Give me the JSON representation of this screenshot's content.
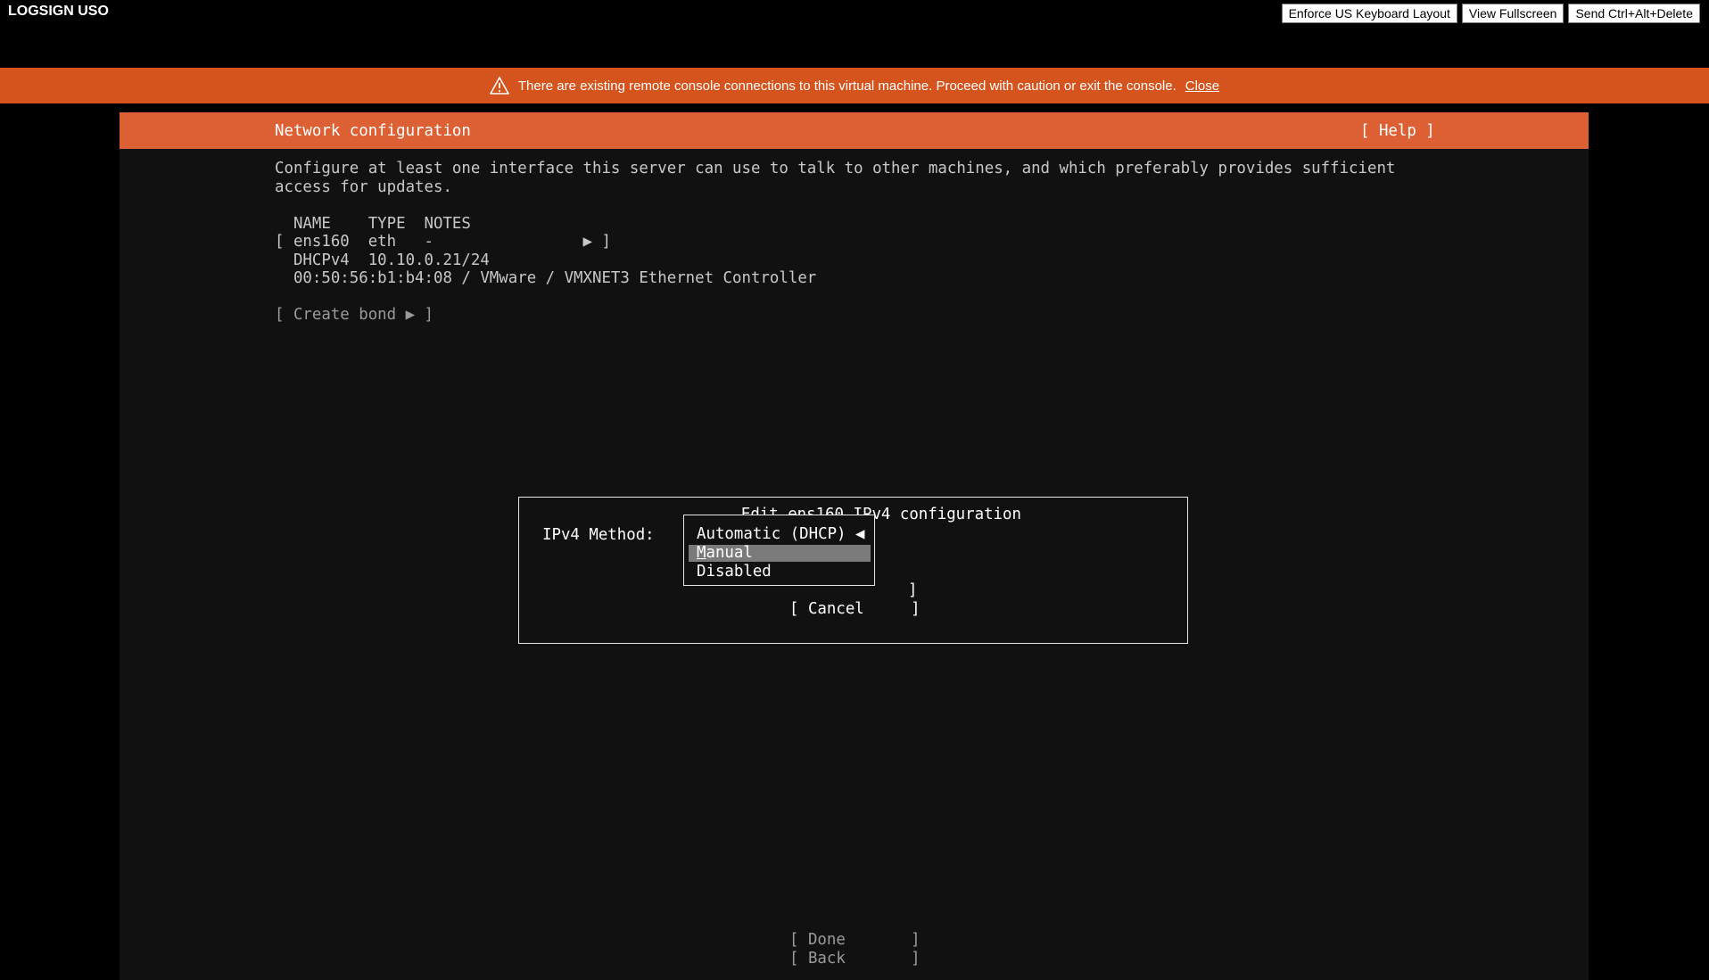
{
  "vm_title": "LOGSIGN USO",
  "top_buttons": {
    "enforce_keyboard": "Enforce US Keyboard Layout",
    "view_fullscreen": "View Fullscreen",
    "send_cad": "Send Ctrl+Alt+Delete"
  },
  "banner": {
    "message": "There are existing remote console connections to this virtual machine. Proceed with caution or exit the console.",
    "close_label": "Close"
  },
  "console": {
    "header_title": "Network configuration",
    "help_button": "[ Help ]",
    "description_line1": "Configure at least one interface this server can use to talk to other machines, and which preferably provides sufficient",
    "description_line2": "access for updates.",
    "table_header": "  NAME    TYPE  NOTES",
    "interface_row": "[ ens160  eth   -                ▶ ]",
    "interface_dhcp": "  DHCPv4  10.10.0.21/24",
    "interface_mac": "  00:50:56:b1:b4:08 / VMware / VMXNET3 Ethernet Controller",
    "create_bond": "[ Create bond ▶ ]",
    "done_button": "[ Done       ]",
    "back_button": "[ Back       ]"
  },
  "dialog": {
    "title": "Edit ens160 IPv4 configuration",
    "method_label": "IPv4 Method:",
    "options": [
      "Automatic (DHCP) ◀",
      "anual",
      "Disabled"
    ],
    "manual_hotkey": "M",
    "save_bracket": "]",
    "cancel_button": "[ Cancel     ]"
  },
  "colors": {
    "header_bg": "#dd5f34",
    "banner_bg": "#d5531c",
    "console_bg": "#111111",
    "selected_option_bg": "#7a7a7a"
  }
}
